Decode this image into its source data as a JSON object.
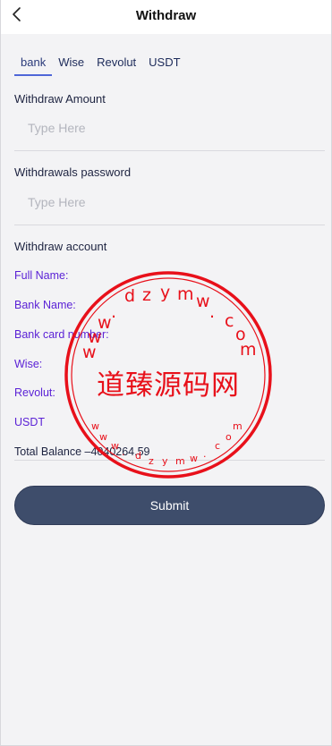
{
  "header": {
    "title": "Withdraw",
    "back_icon": "chevron-left-icon"
  },
  "tabs": [
    {
      "label": "bank",
      "active": true
    },
    {
      "label": "Wise",
      "active": false
    },
    {
      "label": "Revolut",
      "active": false
    },
    {
      "label": "USDT",
      "active": false
    }
  ],
  "form": {
    "amount_label": "Withdraw Amount",
    "amount_placeholder": "Type Here",
    "password_label": "Withdrawals password",
    "password_placeholder": "Type Here",
    "account_label": "Withdraw account"
  },
  "account": {
    "full_name": "Full Name:",
    "bank_name": "Bank Name:",
    "bank_card_number": "Bank card number:",
    "wise": "Wise:",
    "revolut": "Revolut:",
    "usdt": "USDT"
  },
  "total_balance": "Total Balance –4040264.59",
  "submit_label": "Submit",
  "watermark": {
    "center_text": "道臻源码网",
    "ring_text": "www.dzymw.com",
    "color": "#e8101a"
  },
  "colors": {
    "accent": "#4f66d8",
    "button": "#3e4d6b",
    "account_text": "#5b22d6"
  }
}
